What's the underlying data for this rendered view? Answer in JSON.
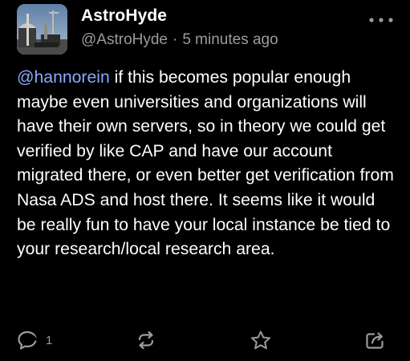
{
  "post": {
    "author": {
      "display_name": "AstroHyde",
      "handle": "@AstroHyde"
    },
    "separator": "·",
    "time_ago": "5 minutes ago",
    "content": {
      "mention": "@hannorein",
      "text": " if this becomes popular enough maybe even universities and organizations will have their own servers, so in theory we could get verified by like CAP and have our account migrated there, or even better get verification from Nasa ADS and host there. It seems like it would be really fun to have your local instance be tied to your research/local research area."
    },
    "actions": {
      "reply_count": "1",
      "reply_icon": "reply-icon",
      "boost_icon": "boost-icon",
      "favourite_icon": "star-icon",
      "share_icon": "share-icon"
    },
    "more_icon": "more-dots-icon"
  },
  "colors": {
    "background": "#000000",
    "text": "#ffffff",
    "secondary": "#9a9aa0",
    "mention": "#8aa8ff"
  }
}
